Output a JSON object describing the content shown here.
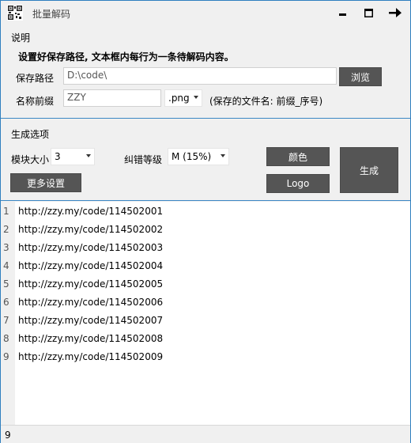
{
  "window": {
    "title": "批量解码",
    "minimize_glyph": "—",
    "maximize_glyph": "□",
    "exit_glyph": "→"
  },
  "description": {
    "heading": "说明",
    "text": "设置好保存路径, 文本框内每行为一条待解码内容。"
  },
  "save": {
    "path_label": "保存路径",
    "path_value": "D:\\code\\",
    "browse_label": "浏览",
    "prefix_label": "名称前缀",
    "prefix_value": "ZZY",
    "extension": ".png",
    "filename_hint": "(保存的文件名: 前缀_序号)"
  },
  "options": {
    "heading": "生成选项",
    "module_size_label": "模块大小",
    "module_size_value": "3",
    "ecc_label": "纠错等级",
    "ecc_value": "M (15%)",
    "more_settings_label": "更多设置",
    "color_label": "颜色",
    "logo_label": "Logo",
    "generate_label": "生成"
  },
  "editor": {
    "lines": [
      {
        "num": "1",
        "text": "http://zzy.my/code/114502001"
      },
      {
        "num": "2",
        "text": "http://zzy.my/code/114502002"
      },
      {
        "num": "3",
        "text": "http://zzy.my/code/114502003"
      },
      {
        "num": "4",
        "text": "http://zzy.my/code/114502004"
      },
      {
        "num": "5",
        "text": "http://zzy.my/code/114502005"
      },
      {
        "num": "6",
        "text": "http://zzy.my/code/114502006"
      },
      {
        "num": "7",
        "text": "http://zzy.my/code/114502007"
      },
      {
        "num": "8",
        "text": "http://zzy.my/code/114502008"
      },
      {
        "num": "9",
        "text": "http://zzy.my/code/114502009"
      }
    ]
  },
  "status": {
    "line_count": "9"
  }
}
